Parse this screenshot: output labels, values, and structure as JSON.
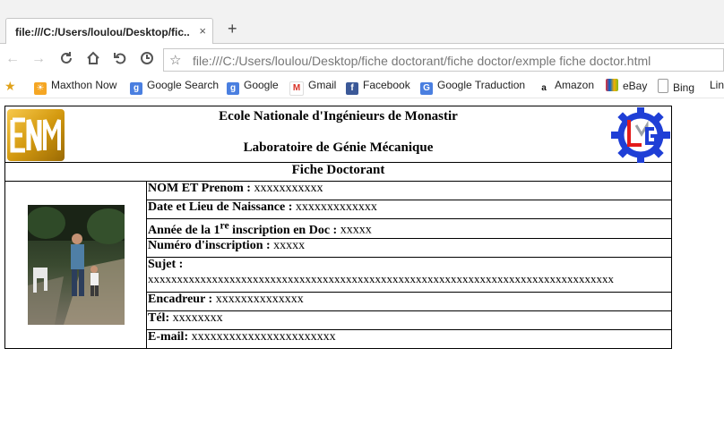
{
  "browser": {
    "tab_title": "file:///C:/Users/loulou/Desktop/fic...",
    "tab_close": "×",
    "new_tab": "+",
    "url": "file:///C:/Users/loulou/Desktop/fiche doctorant/fiche doctor/exmple fiche doctor.html",
    "icons": [
      "back-icon",
      "forward-icon",
      "reload-icon",
      "home-icon",
      "undo-icon",
      "history-icon",
      "bookmark-star-icon"
    ],
    "bookmarks": [
      {
        "label": "Maxthon Now",
        "icon": "maxthon-icon"
      },
      {
        "label": "Google Search",
        "icon": "google-icon"
      },
      {
        "label": "Google",
        "icon": "google-icon"
      },
      {
        "label": "Gmail",
        "icon": "gmail-icon"
      },
      {
        "label": "Facebook",
        "icon": "facebook-icon"
      },
      {
        "label": "Google Traduction",
        "icon": "translate-icon"
      },
      {
        "label": "Amazon",
        "icon": "amazon-icon"
      },
      {
        "label": "eBay",
        "icon": "ebay-icon"
      },
      {
        "label": "Bing",
        "icon": "page-icon"
      },
      {
        "label": "Lin",
        "icon": "page-icon"
      }
    ]
  },
  "page": {
    "school": "Ecole Nationale d'Ingénieurs de Monastir",
    "lab": "Laboratoire de Génie Mécanique",
    "title": "Fiche Doctorant",
    "logo_left_text": "ENIM",
    "logo_right_text": "LGM",
    "fields": {
      "nom": {
        "label": "NOM ET Prenom :",
        "value": "xxxxxxxxxxx"
      },
      "naissance": {
        "label": "Date et Lieu de Naissance :",
        "value": "xxxxxxxxxxxxx"
      },
      "inscription_pre": "Année de la 1",
      "inscription_sup": "re",
      "inscription_post": " inscription en Doc :",
      "inscription_value": "xxxxx",
      "numero": {
        "label": "Numéro d'inscription :",
        "value": "xxxxx"
      },
      "sujet": {
        "label": "Sujet :",
        "value": "xxxxxxxxxxxxxxxxxxxxxxxxxxxxxxxxxxxxxxxxxxxxxxxxxxxxxxxxxxxxxxxxxxxxxxxxxxxxxxxx"
      },
      "encadreur": {
        "label": "Encadreur :",
        "value": "xxxxxxxxxxxxxx"
      },
      "tel": {
        "label": "Tél:",
        "value": "xxxxxxxx"
      },
      "email": {
        "label": "E-mail:",
        "value": "xxxxxxxxxxxxxxxxxxxxxxx"
      }
    }
  },
  "colors": {
    "enim_gold": "#d49a10",
    "lgm_blue": "#1f3fd6",
    "lgm_red": "#e31b1b",
    "bookmark_star": "#e0a21b"
  }
}
